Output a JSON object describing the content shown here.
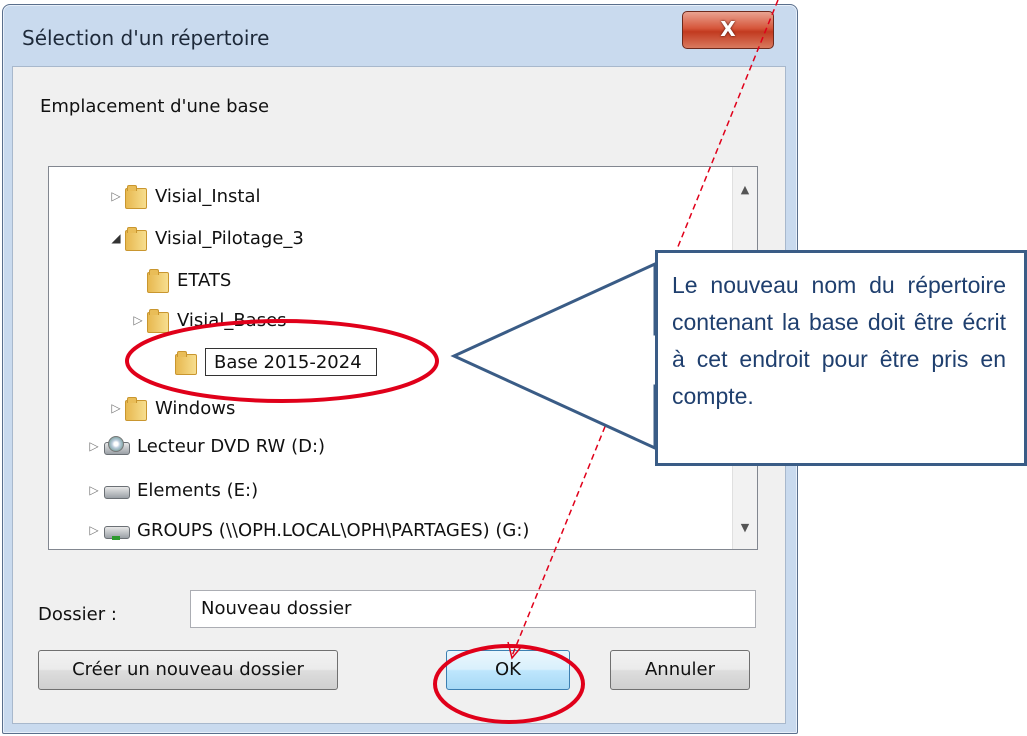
{
  "window": {
    "title": "Sélection d'un répertoire",
    "close_label": "X"
  },
  "heading": "Emplacement d'une base",
  "tree": {
    "items": [
      {
        "label": "Visial_Instal",
        "icon": "folder-icon",
        "expander": "▷"
      },
      {
        "label": "Visial_Pilotage_3",
        "icon": "folder-icon",
        "expander": "◢"
      },
      {
        "label": "ETATS",
        "icon": "folder-icon",
        "expander": ""
      },
      {
        "label": "Visial_Bases",
        "icon": "folder-icon",
        "expander": "▷"
      },
      {
        "label": "Base 2015-2024",
        "icon": "folder-icon",
        "expander": "",
        "editing": true
      },
      {
        "label": "Windows",
        "icon": "folder-icon",
        "expander": "▷"
      },
      {
        "label": "Lecteur DVD RW (D:)",
        "icon": "dvd-drive-icon",
        "expander": "▷"
      },
      {
        "label": "Elements (E:)",
        "icon": "drive-icon",
        "expander": "▷"
      },
      {
        "label": "GROUPS (\\\\OPH.LOCAL\\OPH\\PARTAGES) (G:)",
        "icon": "network-drive-icon",
        "expander": "▷"
      }
    ],
    "scroll_up": "▲",
    "scroll_down": "▼"
  },
  "dossier": {
    "label": "Dossier :",
    "value": "Nouveau dossier"
  },
  "buttons": {
    "new_folder": "Créer un nouveau dossier",
    "ok": "OK",
    "cancel": "Annuler"
  },
  "callout": {
    "text": "Le nouveau nom du répertoire contenant la base doit être écrit à cet endroit pour être pris en compte."
  },
  "colors": {
    "annotation_red": "#e0001a",
    "callout_border": "#3a5c86",
    "callout_text": "#1f3f6e"
  }
}
